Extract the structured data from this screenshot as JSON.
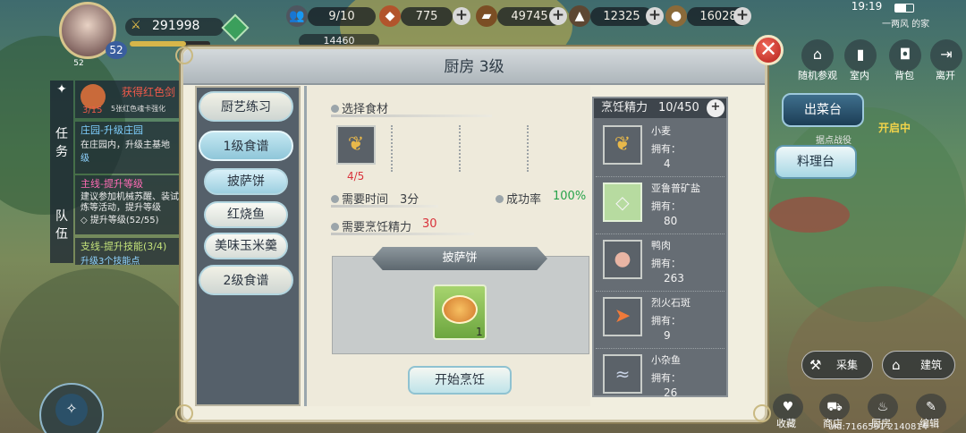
{
  "hud": {
    "time": "19:19",
    "home_label": "一两风 的家",
    "uid": "uid:7166591 2140814",
    "player_level": "52",
    "player_level_small": "52",
    "power": "291998",
    "resources": [
      {
        "icon": "people-icon",
        "value": "9/10"
      },
      {
        "icon": "ore-icon",
        "value": "775"
      },
      {
        "icon": "wood-icon",
        "value": "49745"
      },
      {
        "icon": "stone-icon",
        "value": "12325"
      },
      {
        "icon": "gold-icon",
        "value": "16028"
      }
    ],
    "partial_value": "14460",
    "top_right_buttons": [
      {
        "icon": "house-icon",
        "label": "随机参观"
      },
      {
        "icon": "door-icon",
        "label": "室内"
      },
      {
        "icon": "bag-icon",
        "label": "背包"
      },
      {
        "icon": "exit-icon",
        "label": "离开"
      }
    ],
    "side_buttons": {
      "serve": "出菜台",
      "cook": "料理台"
    },
    "status_open": "开启中",
    "status_sub": "据点战役",
    "bottom_buttons": [
      {
        "icon": "shovel-icon",
        "label": "采集"
      },
      {
        "icon": "building-icon",
        "label": "建筑"
      }
    ],
    "bottom_small_buttons": [
      {
        "icon": "collect-icon",
        "label": "收藏"
      },
      {
        "icon": "cart-icon",
        "label": "商店"
      },
      {
        "icon": "kitchen-icon",
        "label": "厨房"
      },
      {
        "icon": "wrench-icon",
        "label": "编辑"
      }
    ]
  },
  "quests": {
    "reward_title": "获得红色剑",
    "reward_progress": "3/15",
    "reward_desc": "5张红色魂卡强化",
    "tab_task": "任务",
    "tab_team": "队伍",
    "items": [
      {
        "title": "庄园-升级庄园",
        "desc": "在庄园内，升级主基地",
        "extra": "级"
      },
      {
        "title": "主线-提升等级",
        "desc": "建议参加机械苏醒、装试炼等活动，提升等级",
        "extra": "◇ 提升等级(52/55)"
      },
      {
        "title": "支线-提升技能(3/4)",
        "desc": "升级3个技能点",
        "extra": ""
      }
    ]
  },
  "kitchen": {
    "title": "厨房 3级",
    "tabs": [
      "厨艺练习",
      "1级食谱",
      "2级食谱"
    ],
    "recipes": [
      "披萨饼",
      "红烧鱼",
      "美味玉米羹"
    ],
    "select_label": "选择食材",
    "slot_count": "4/5",
    "time_label": "需要时间",
    "time_value": "3分",
    "success_label": "成功率",
    "success_value": "100%",
    "energy_label": "需要烹饪精力",
    "energy_value": "30",
    "recipe_name": "披萨饼",
    "dish_count": "1",
    "start_button": "开始烹饪",
    "energy_header_label": "烹饪精力",
    "energy_header_value": "10/450",
    "own_label": "拥有：",
    "ingredients": [
      {
        "name": "小麦",
        "count": "4",
        "icon": "wheat-icon"
      },
      {
        "name": "亚鲁普矿盐",
        "count": "80",
        "icon": "salt-icon"
      },
      {
        "name": "鸭肉",
        "count": "263",
        "icon": "meat-icon"
      },
      {
        "name": "烈火石斑",
        "count": "9",
        "icon": "fish-icon"
      },
      {
        "name": "小杂鱼",
        "count": "26",
        "icon": "small-fish-icon"
      }
    ]
  },
  "colors": {
    "accent_red": "#d9323b",
    "success_green": "#27a34a",
    "panel_dark": "#666d74"
  }
}
